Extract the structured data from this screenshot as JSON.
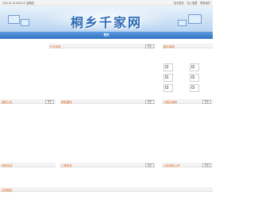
{
  "topbar": {
    "datetime": "2021-01-31 08:51:21 星期四",
    "links": [
      "设为首页",
      "加入收藏",
      "联系我们"
    ]
  },
  "site": {
    "title": "桐乡千家网"
  },
  "nav": {
    "home": "首页"
  },
  "sections": {
    "industry": {
      "title": "行业动态",
      "more": "更多"
    },
    "images": {
      "title": "图片新闻"
    },
    "notice": {
      "title": "通知公告",
      "more": "更多"
    },
    "policy": {
      "title": "政策通知",
      "more": "更多"
    },
    "topnews": {
      "title": "六图片新闻",
      "more": "更多"
    },
    "work": {
      "title": "在职交流"
    },
    "engineering": {
      "title": "工程信息",
      "more": "更多"
    },
    "services": {
      "title": "公告信息公开",
      "more": "更多"
    },
    "links": {
      "title": "友情链接"
    }
  },
  "colors": {
    "accent": "#2f72c2",
    "section_title": "#e0641e"
  }
}
